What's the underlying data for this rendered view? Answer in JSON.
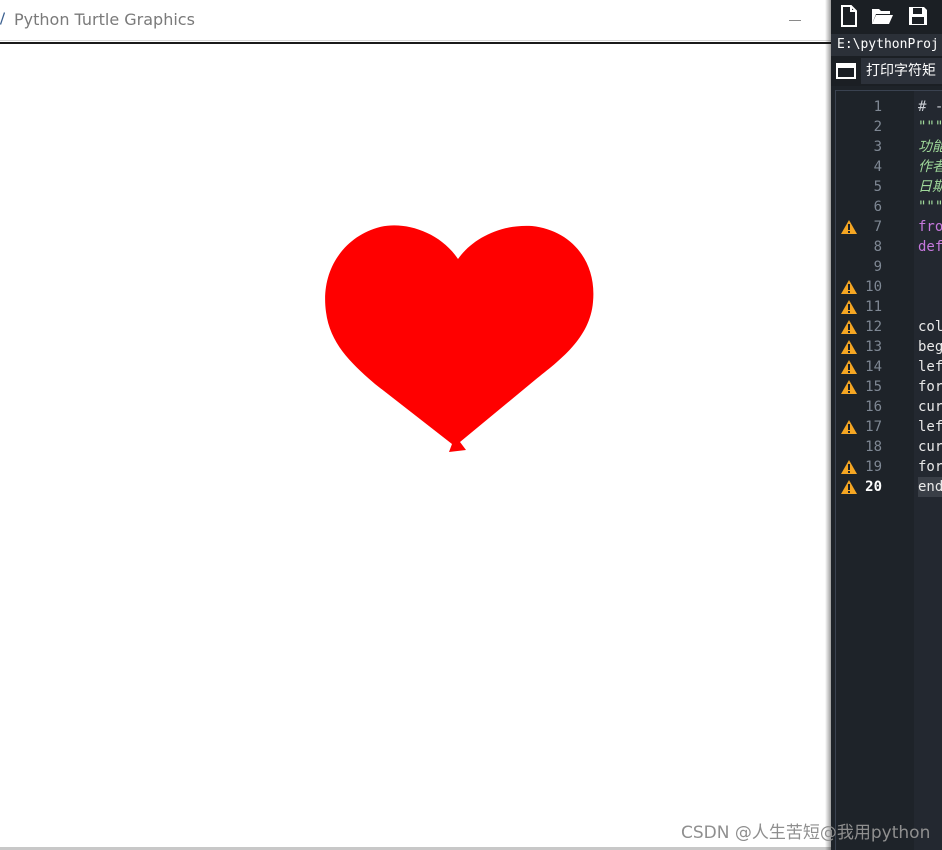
{
  "turtle_window": {
    "title": "Python Turtle Graphics",
    "heart_color": "#ff0000"
  },
  "editor": {
    "path": "E:\\pythonProj",
    "tab_label": "打印字符矩",
    "current_line": 20,
    "lines": [
      {
        "num": "1",
        "code": "# -",
        "style": "comment",
        "warn": false
      },
      {
        "num": "2",
        "code": "\"\"\"",
        "style": "doc",
        "warn": false
      },
      {
        "num": "3",
        "code": "功能",
        "style": "doc",
        "warn": false
      },
      {
        "num": "4",
        "code": "作者",
        "style": "doc",
        "warn": false
      },
      {
        "num": "5",
        "code": "日期",
        "style": "doc",
        "warn": false
      },
      {
        "num": "6",
        "code": "\"\"\"",
        "style": "doc",
        "warn": false
      },
      {
        "num": "7",
        "code": "fro",
        "style": "kw",
        "warn": true
      },
      {
        "num": "8",
        "code": "def",
        "style": "kw",
        "warn": false
      },
      {
        "num": "9",
        "code": "",
        "style": "plain",
        "warn": false
      },
      {
        "num": "10",
        "code": "",
        "style": "plain",
        "warn": true
      },
      {
        "num": "11",
        "code": "",
        "style": "plain",
        "warn": true
      },
      {
        "num": "12",
        "code": "col",
        "style": "plain",
        "warn": true
      },
      {
        "num": "13",
        "code": "beg",
        "style": "plain",
        "warn": true
      },
      {
        "num": "14",
        "code": "lef",
        "style": "plain",
        "warn": true
      },
      {
        "num": "15",
        "code": "for",
        "style": "plain",
        "warn": true
      },
      {
        "num": "16",
        "code": "cur",
        "style": "plain",
        "warn": false
      },
      {
        "num": "17",
        "code": "lef",
        "style": "plain",
        "warn": true
      },
      {
        "num": "18",
        "code": "cur",
        "style": "plain",
        "warn": false
      },
      {
        "num": "19",
        "code": "for",
        "style": "plain",
        "warn": true
      },
      {
        "num": "20",
        "code": "end",
        "style": "plain",
        "warn": true
      }
    ]
  },
  "watermark": "CSDN @人生苦短@我用python"
}
